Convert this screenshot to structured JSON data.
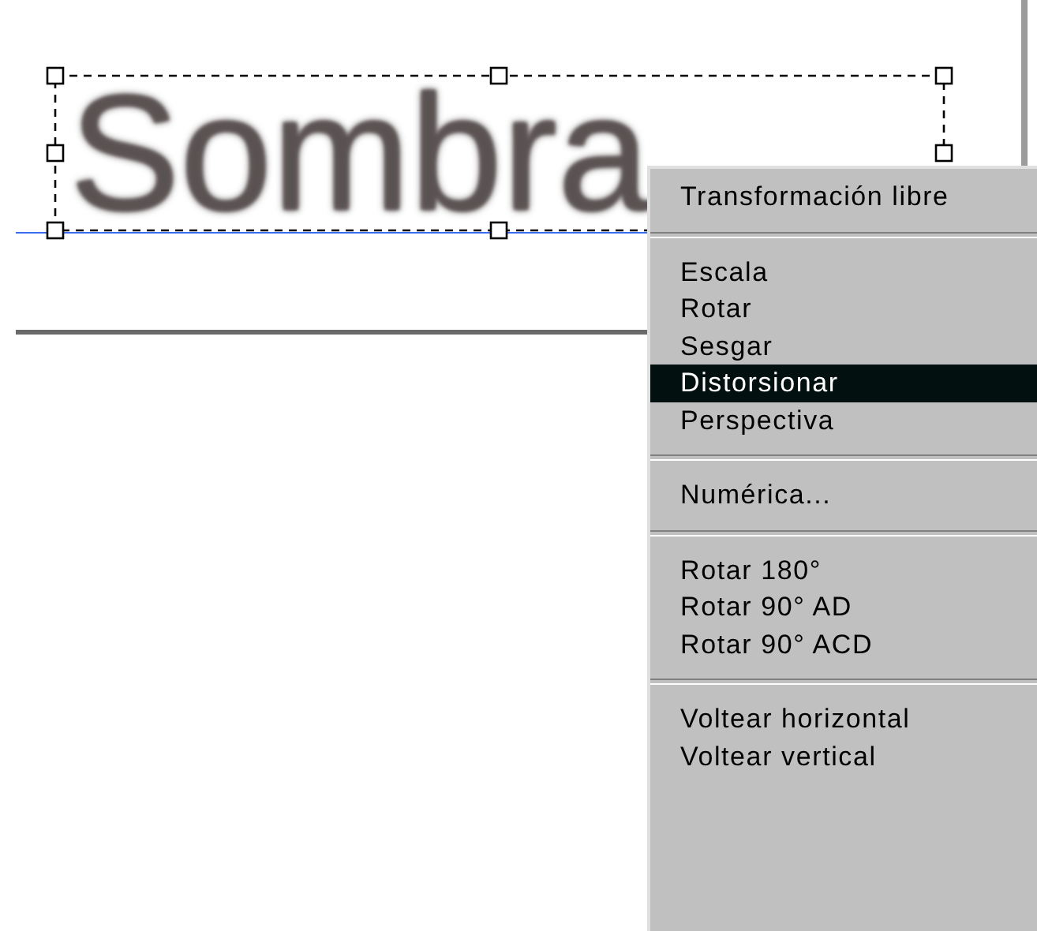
{
  "canvas": {
    "text": "Sombra"
  },
  "context_menu": {
    "groups": [
      [
        {
          "label": "Transformación libre",
          "selected": false
        }
      ],
      [
        {
          "label": "Escala",
          "selected": false
        },
        {
          "label": "Rotar",
          "selected": false
        },
        {
          "label": "Sesgar",
          "selected": false
        },
        {
          "label": "Distorsionar",
          "selected": true
        },
        {
          "label": "Perspectiva",
          "selected": false
        }
      ],
      [
        {
          "label": "Numérica...",
          "selected": false
        }
      ],
      [
        {
          "label": "Rotar 180°",
          "selected": false
        },
        {
          "label": "Rotar 90° AD",
          "selected": false
        },
        {
          "label": "Rotar 90° ACD",
          "selected": false
        }
      ],
      [
        {
          "label": "Voltear horizontal",
          "selected": false
        },
        {
          "label": "Voltear vertical",
          "selected": false
        }
      ]
    ]
  }
}
